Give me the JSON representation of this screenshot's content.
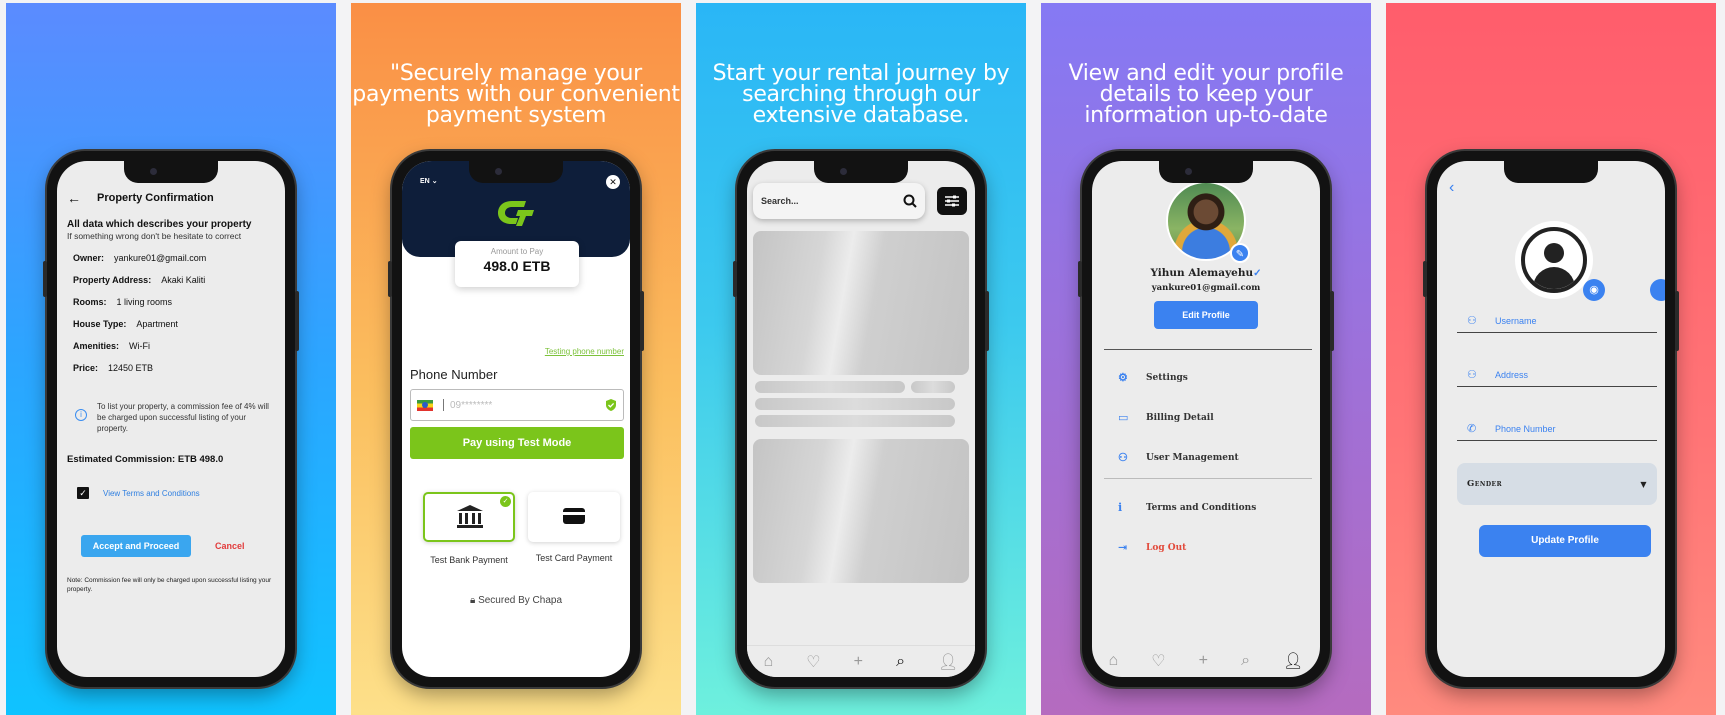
{
  "panels": {
    "p2_headline": "\"Securely manage your payments with our convenient payment system",
    "p3_headline": "Start your rental journey by searching through our extensive database.",
    "p4_headline": "View and edit your profile details to keep your information up-to-date"
  },
  "confirm": {
    "back_icon": "arrow-left-icon",
    "title": "Property Confirmation",
    "intro_title": "All data which describes your property",
    "intro_sub": "If something wrong don't be hesitate to correct",
    "rows": [
      {
        "k": "Owner:",
        "v": "yankure01@gmail.com"
      },
      {
        "k": "Property Address:",
        "v": "Akaki Kaliti"
      },
      {
        "k": "Rooms:",
        "v": "1 living rooms"
      },
      {
        "k": "House Type:",
        "v": "Apartment"
      },
      {
        "k": "Amenities:",
        "v": "Wi-Fi"
      },
      {
        "k": "Price:",
        "v": "12450 ETB"
      }
    ],
    "notice": "To list your property, a commission fee of 4% will be charged upon successful listing of your property.",
    "estimated": "Estimated Commission:  ETB 498.0",
    "terms_link": "View Terms and Conditions",
    "accept_label": "Accept and Proceed",
    "cancel_label": "Cancel",
    "footnote": "Note: Commission fee will only be charged upon successful listing your property."
  },
  "payment": {
    "lang": "EN",
    "amount_label": "Amount to Pay",
    "amount_value": "498.0 ETB",
    "test_link": "Testing phone number",
    "phone_label": "Phone Number",
    "phone_placeholder": "09********",
    "pay_label": "Pay using Test Mode",
    "opt_bank": "Test Bank Payment",
    "opt_card": "Test Card Payment",
    "secured": "Secured By Chapa",
    "accent": "#7bc51b"
  },
  "search": {
    "placeholder": "Search..."
  },
  "profile": {
    "name": "Yihun Alemayehu",
    "email": "yankure01@gmail.com",
    "edit_label": "Edit Profile",
    "items": {
      "settings": "Settings",
      "billing": "Billing Detail",
      "users": "User Management",
      "terms": "Terms and Conditions",
      "logout": "Log Out"
    }
  },
  "edit": {
    "username": "Username",
    "address": "Address",
    "phone": "Phone Number",
    "gender": "Gender",
    "update_label": "Update Profile"
  }
}
